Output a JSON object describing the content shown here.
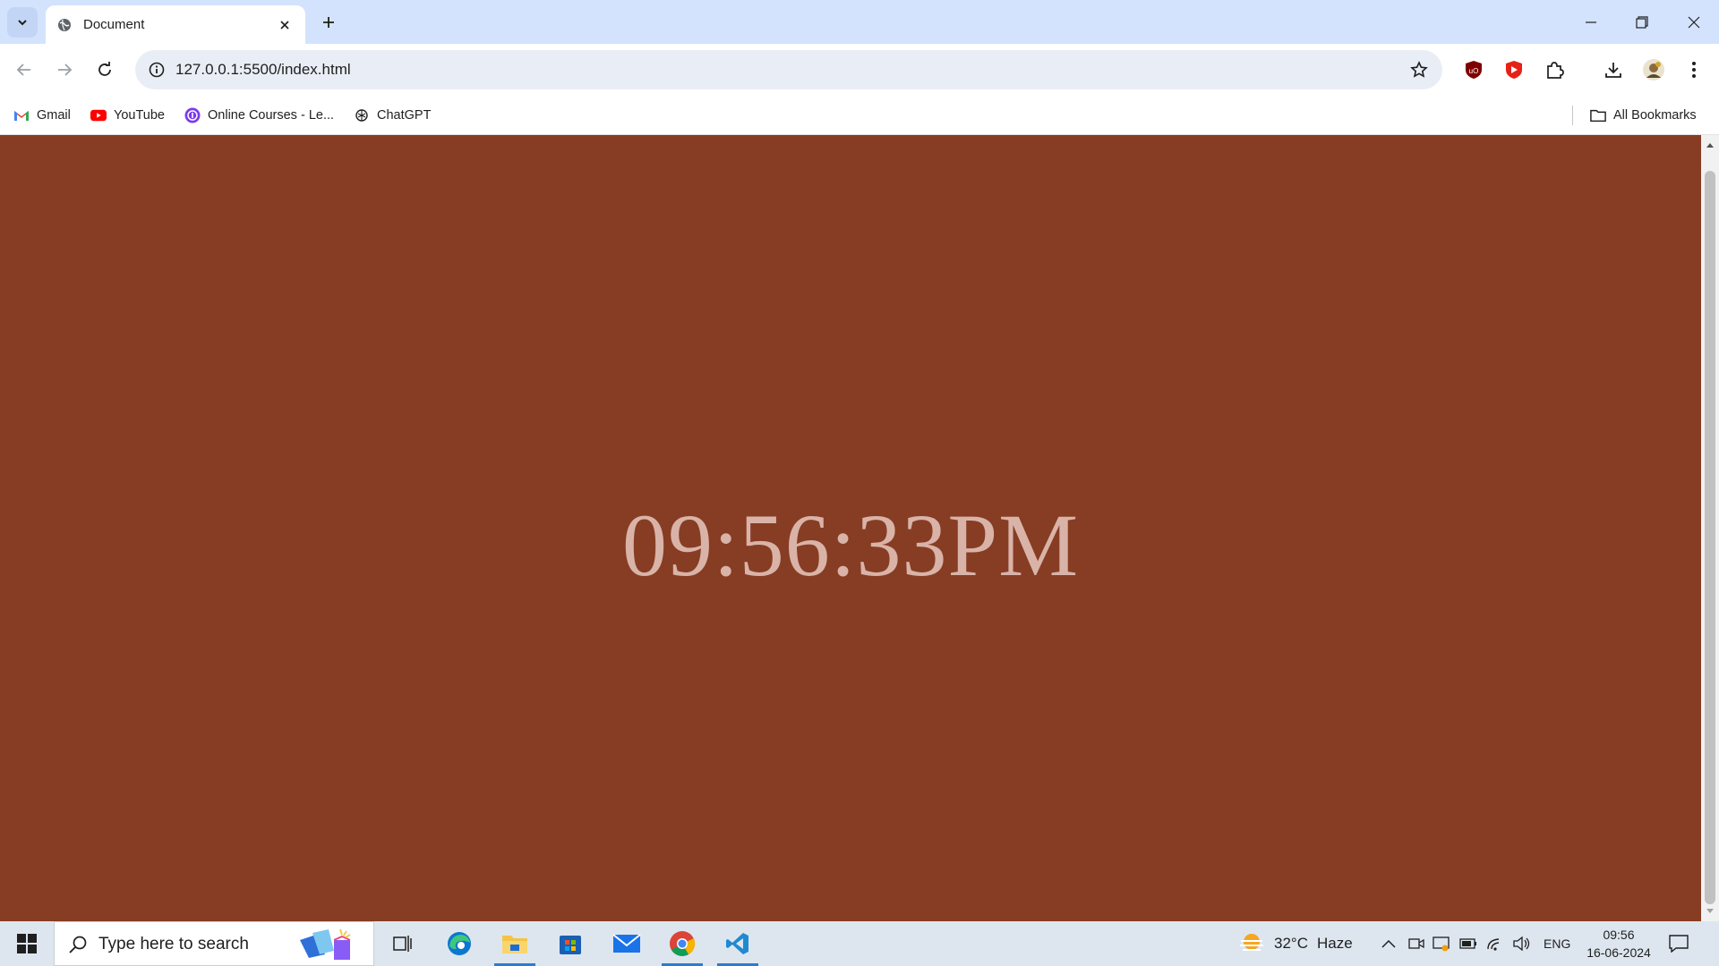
{
  "browser": {
    "tab": {
      "title": "Document"
    },
    "omnibox": {
      "url": "127.0.0.1:5500/index.html"
    },
    "bookmarks": [
      {
        "label": "Gmail",
        "icon": "gmail-icon"
      },
      {
        "label": "YouTube",
        "icon": "youtube-icon"
      },
      {
        "label": "Online Courses - Le...",
        "icon": "courses-icon"
      },
      {
        "label": "ChatGPT",
        "icon": "chatgpt-icon"
      }
    ],
    "all_bookmarks_label": "All Bookmarks"
  },
  "page": {
    "time": "09:56:33PM",
    "background_color": "#873d23",
    "text_color": "#d9b3a8"
  },
  "taskbar": {
    "search_placeholder": "Type here to search",
    "weather": {
      "temp": "32°C",
      "condition": "Haze"
    },
    "language": "ENG",
    "time": "09:56",
    "date": "16-06-2024"
  }
}
